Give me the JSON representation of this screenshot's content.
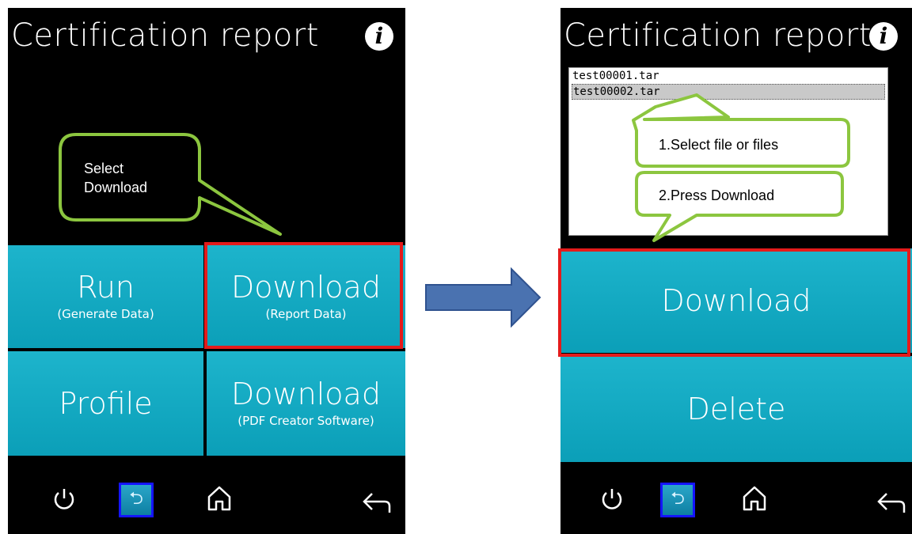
{
  "left_screen": {
    "title": "Certification report",
    "tiles": {
      "run": {
        "label": "Run",
        "sub": "(Generate Data)"
      },
      "download_report": {
        "label": "Download",
        "sub": "(Report Data)"
      },
      "profile": {
        "label": "Profile"
      },
      "download_pdf": {
        "label": "Download",
        "sub": "(PDF Creator Software)"
      }
    },
    "callout": {
      "line1": "Select",
      "line2": "Download"
    }
  },
  "right_screen": {
    "title": "Certification report",
    "files": [
      "test00001.tar",
      "test00002.tar"
    ],
    "selected_file": "test00002.tar",
    "callouts": {
      "step1": "1.Select file or files",
      "step2": "2.Press Download"
    },
    "buttons": {
      "download": "Download",
      "delete": "Delete"
    }
  },
  "bottom_bar": {
    "icons": [
      "power-icon",
      "usb-icon",
      "home-icon",
      "back-icon"
    ]
  },
  "colors": {
    "tile": "#13a9c2",
    "highlight": "#e41b1b",
    "callout_border": "#8cc63f",
    "arrow": "#4a72b0",
    "usb_border": "#1515ff"
  }
}
